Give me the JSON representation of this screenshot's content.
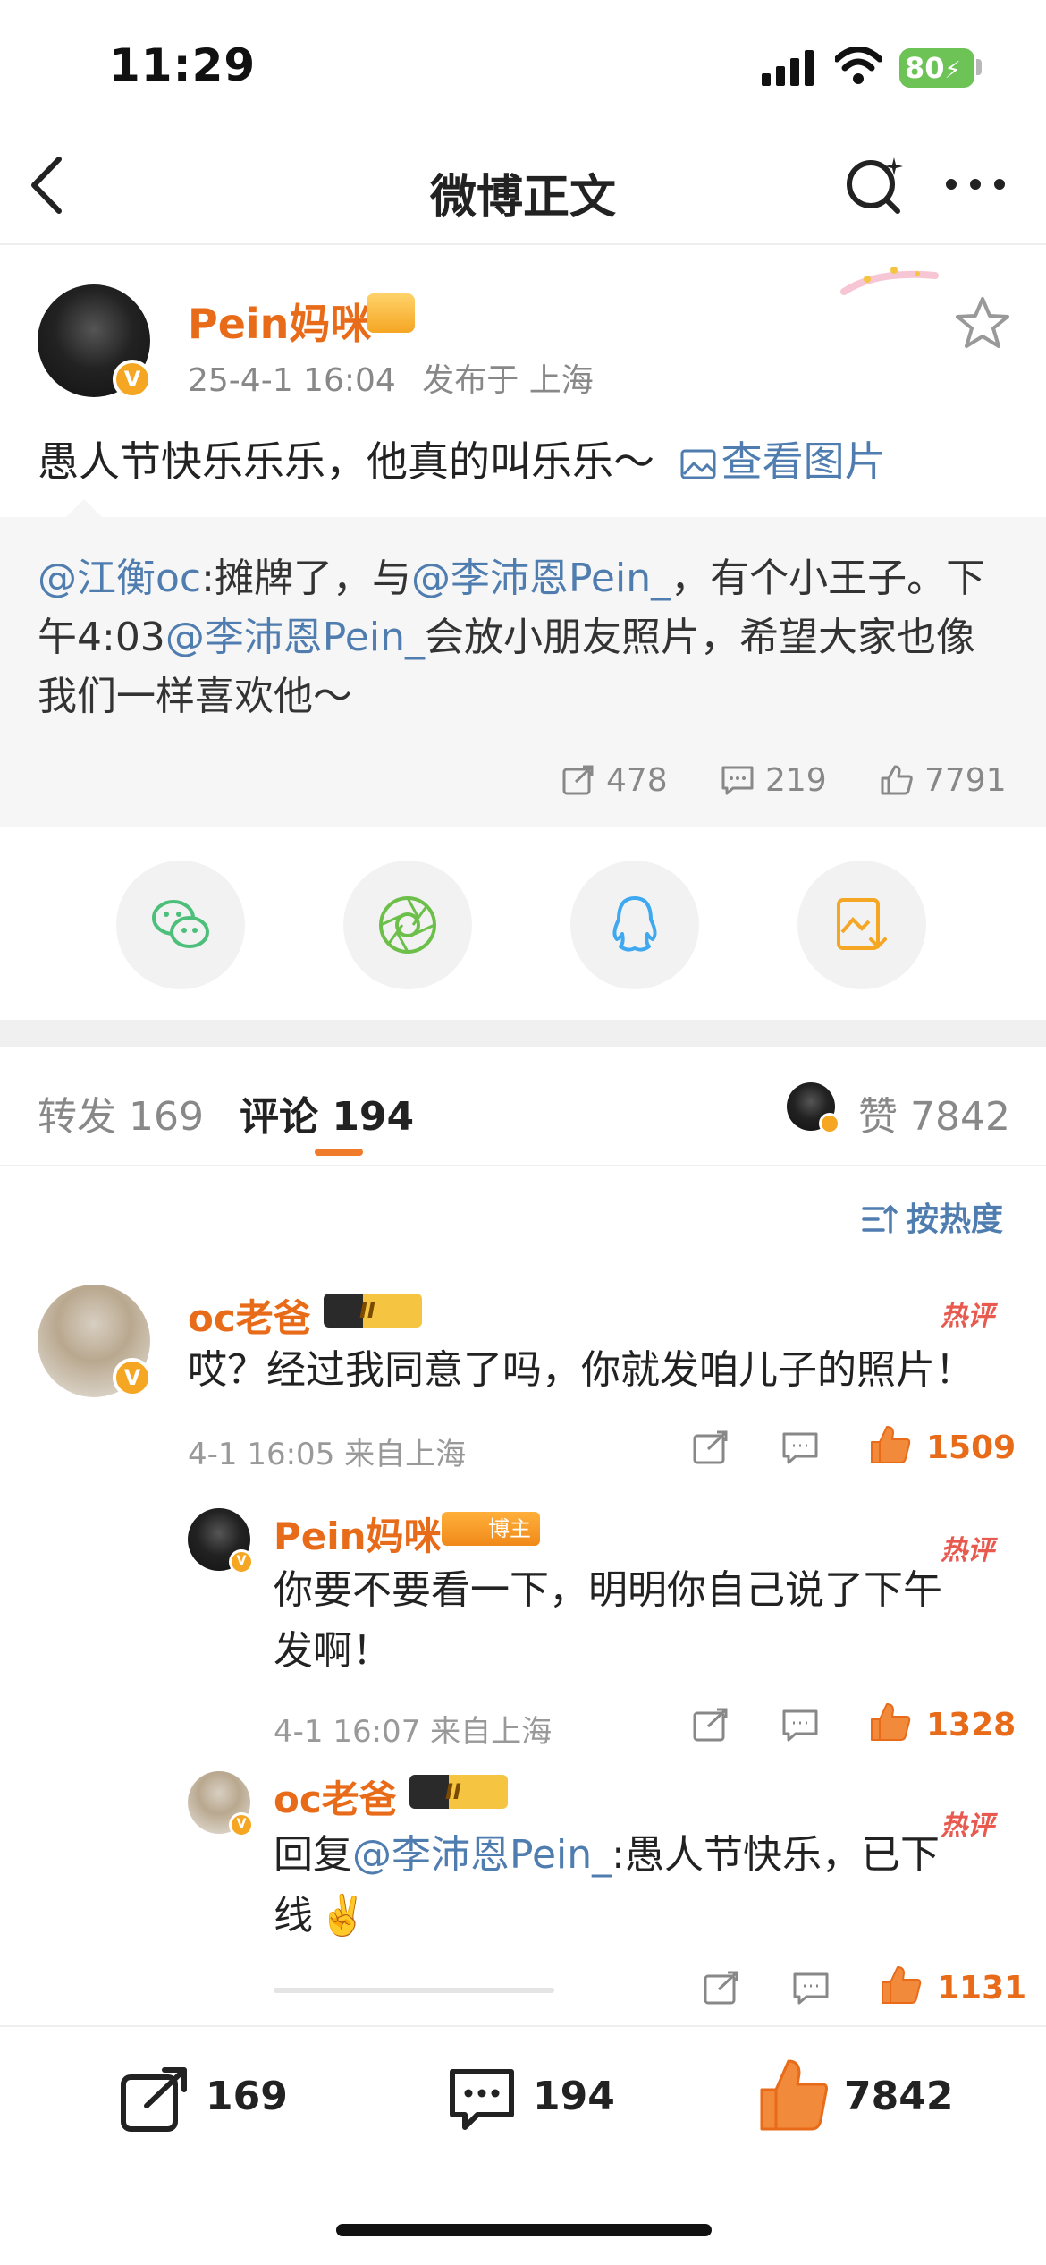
{
  "status_bar": {
    "time": "11:29",
    "battery": "80"
  },
  "nav": {
    "title": "微博正文"
  },
  "post": {
    "author": "Pein妈咪",
    "date": "25-4-1 16:04",
    "location": "发布于 上海",
    "text": "愚人节快乐乐乐，他真的叫乐乐～",
    "view_images": "查看图片"
  },
  "quote": {
    "mention1": "@江衡oc",
    "part1": ":摊牌了，与",
    "mention2": "@李沛恩Pein_",
    "part2": "，有个小王子。下午4:03",
    "mention3": "@李沛恩Pein_",
    "part3": "会放小朋友照片，希望大家也像我们一样喜欢他～",
    "reposts": "478",
    "comments": "219",
    "likes": "7791"
  },
  "share": [
    "wechat-icon",
    "moments-icon",
    "qq-icon",
    "save-image-icon"
  ],
  "tabs": {
    "repost": "转发 169",
    "comment": "评论 194",
    "likes": "赞 7842"
  },
  "sort": {
    "label": "按热度"
  },
  "comments": [
    {
      "name": "oc老爸",
      "level": "II",
      "hot": "热评",
      "text": "哎？经过我同意了吗，你就发咱儿子的照片！",
      "meta": "4-1 16:05 来自上海",
      "likes": "1509"
    },
    {
      "name": "Pein妈咪",
      "badge": "博主",
      "hot": "热评",
      "text_line1": "你要不要看一下，明明你自己说了下午",
      "text_line2": "发啊！",
      "meta": "4-1 16:07 来自上海",
      "likes": "1328"
    },
    {
      "name": "oc老爸",
      "level": "II",
      "hot": "热评",
      "reply_prefix": "回复",
      "mention": "@李沛恩Pein_",
      "text_line1": ":愚人节快乐，已下",
      "text_line2": "线",
      "emoji": "✌️",
      "likes": "1131"
    }
  ],
  "bottom_bar": {
    "reposts": "169",
    "comments": "194",
    "likes": "7842"
  },
  "colors": {
    "accent": "#e86b1a",
    "link": "#507daf",
    "hot": "#e85a4f"
  }
}
